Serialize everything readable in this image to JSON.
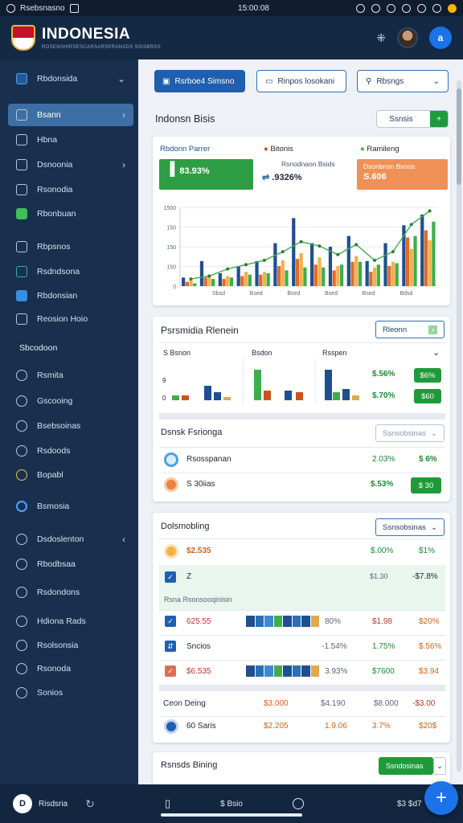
{
  "status_bar": {
    "app": "Rsebsnasno",
    "time": "15:00:08"
  },
  "header": {
    "title": "INDONESIA",
    "subtitle": "ROSENSHIRSESCARSARSPRANSDS SSISBRSS"
  },
  "sidebar": {
    "top_item": "Rbdonsida",
    "items": [
      {
        "label": "Bsann",
        "icon": "document-icon"
      },
      {
        "label": "Hbna",
        "icon": "box-icon"
      },
      {
        "label": "Dsnoonia",
        "icon": "home-icon"
      },
      {
        "label": "Rsonodia",
        "icon": "person-icon"
      },
      {
        "label": "Rbonbuan",
        "icon": "pencil-icon"
      },
      {
        "label": "Rbpsnos",
        "icon": "folder-icon"
      },
      {
        "label": "Rsdndsona",
        "icon": "chart-icon"
      },
      {
        "label": "Rbdonsian",
        "icon": "window-icon"
      },
      {
        "label": "Reosion Hoio",
        "icon": "link-icon"
      }
    ],
    "section_label": "Sbcodoon",
    "items2": [
      {
        "label": "Rsmita",
        "icon": "profile-icon"
      },
      {
        "label": "Gscooing",
        "icon": "tag-icon"
      },
      {
        "label": "Bsebsoinas",
        "icon": "list-icon"
      },
      {
        "label": "Rsdoods",
        "icon": "chart-circle-icon"
      },
      {
        "label": "Bopabl",
        "icon": "badge-icon"
      },
      {
        "label": "Bsmosia",
        "icon": "globe-icon"
      },
      {
        "label": "Dsdoslenton",
        "icon": "calendar-icon"
      },
      {
        "label": "Rbodbsaa",
        "icon": "layers-icon"
      },
      {
        "label": "Rsdondons",
        "icon": "grid-icon"
      },
      {
        "label": "Hdiona Rads",
        "icon": "flag-icon"
      },
      {
        "label": "Rsolsonsia",
        "icon": "info-icon"
      },
      {
        "label": "Rsonoda",
        "icon": "users-icon"
      },
      {
        "label": "Sonios",
        "icon": "settings-icon"
      }
    ]
  },
  "toolbar": {
    "primary": "Rsrboe4 Simsno",
    "second": "Rinpos losokani",
    "dropdown": "Rbsngs"
  },
  "overview": {
    "title": "Indonsn Bisis",
    "action": "Ssnsis",
    "kpis": [
      {
        "label": "Rbdonn Parrer",
        "value": "83.93%"
      },
      {
        "label": "Bitonis",
        "sub": "Rsnodnaon Bsids",
        "value": ".9326%"
      },
      {
        "label": "Ramileng",
        "sub": "Dsonbnsn Bsnos",
        "value": "S.606"
      }
    ]
  },
  "chart_data": {
    "type": "bar",
    "title": "",
    "yticks": [
      "1500",
      "150",
      "150",
      "150",
      "0"
    ],
    "categories": [
      "Sbsd",
      "Bsed",
      "Bsed",
      "Bsed",
      "Bsed",
      "Bdsd"
    ],
    "series": [
      {
        "color": "#1f4f8f",
        "values": [
          12,
          35,
          18,
          28,
          35,
          60,
          95,
          60,
          55,
          70,
          35,
          60,
          85,
          100
        ]
      },
      {
        "color": "#e06a2c",
        "values": [
          6,
          12,
          10,
          14,
          16,
          28,
          38,
          30,
          22,
          34,
          20,
          28,
          68,
          78
        ]
      },
      {
        "color": "#f2b24a",
        "values": [
          8,
          16,
          14,
          20,
          20,
          36,
          46,
          40,
          28,
          42,
          26,
          34,
          52,
          64
        ]
      },
      {
        "color": "#3fae4a",
        "values": [
          4,
          10,
          12,
          16,
          18,
          22,
          26,
          26,
          30,
          34,
          30,
          32,
          70,
          90
        ]
      }
    ],
    "trend": [
      10,
      14,
      24,
      30,
      36,
      48,
      62,
      56,
      44,
      58,
      36,
      48,
      86,
      105
    ],
    "ylim": [
      0,
      110
    ]
  },
  "breakdown": {
    "title": "Psrsmidia Rlenein",
    "select": "Rleonn",
    "headers": [
      "S Bsnon",
      "Bsdon",
      "Rsspen"
    ],
    "rows": [
      {
        "a": "$.56%",
        "b": "$6%"
      },
      {
        "a": "$.70%",
        "b": "$60"
      }
    ]
  },
  "split": {
    "title": "Dsnsk Fsrionga",
    "select": "Ssnsobsinas",
    "rows": [
      {
        "name": "Rsosspanan",
        "a": "2.03%",
        "b": "$ 6%"
      },
      {
        "name": "S 30iias",
        "a": "$.53%",
        "b": "$ 30"
      }
    ]
  },
  "ledger": {
    "title": "Dolsmobling",
    "select": "Ssnsobsinas",
    "rows": [
      {
        "name": "$2.535",
        "a": "$.00%",
        "b": "$1%"
      },
      {
        "name": "Z",
        "a": "$1.30",
        "b": "-$7.8%"
      }
    ],
    "group_label": "Rsna  Rsonsooqinlsin",
    "details": [
      {
        "name": "625.55",
        "pct": "80%",
        "a": "$1.98",
        "b": "$20%"
      },
      {
        "name": "Sncios",
        "pct": "-1.54%",
        "a": "1.75%",
        "b": "$.56%"
      },
      {
        "name": "$6.535",
        "pct": "3.93%",
        "a": "$7600",
        "b": "$3.94"
      }
    ],
    "footer_label": "Ceon Deing",
    "footer_vals": [
      "$3.000",
      "$4.190",
      "$8.000",
      "-$3.00"
    ],
    "footer2": {
      "name": "60 Saris",
      "vals": [
        "$2.205",
        "1.9.06",
        "3.7%",
        "$20$"
      ]
    }
  },
  "bottom_card": {
    "title": "Rsnsds Bining",
    "select": "Ssndosinas"
  },
  "bottom_bar": {
    "name": "Risdsria",
    "center": "$ Bsio",
    "right": "$3 $d7"
  }
}
